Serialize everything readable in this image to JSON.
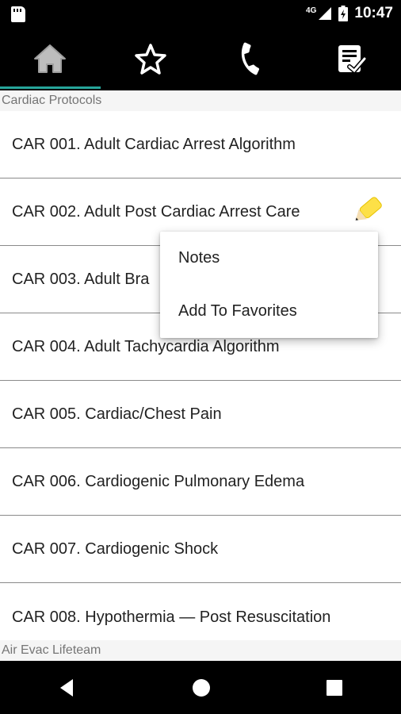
{
  "status_bar": {
    "network": "4G",
    "time": "10:47"
  },
  "tabs": [
    {
      "icon": "home-icon",
      "active": true
    },
    {
      "icon": "star-icon",
      "active": false
    },
    {
      "icon": "phone-icon",
      "active": false
    },
    {
      "icon": "checklist-icon",
      "active": false
    }
  ],
  "section_title": "Cardiac Protocols",
  "protocols": [
    "CAR 001. Adult Cardiac Arrest Algorithm",
    "CAR 002. Adult Post Cardiac Arrest Care",
    "CAR 003. Adult Bra",
    "CAR 004. Adult Tachycardia Algorithm",
    "CAR 005. Cardiac/Chest Pain",
    "CAR 006. Cardiogenic Pulmonary Edema",
    "CAR 007. Cardiogenic Shock",
    "CAR 008. Hypothermia — Post Resuscitation"
  ],
  "context_menu": {
    "notes": "Notes",
    "favorites": "Add To Favorites"
  },
  "footer_label": "Air Evac Lifeteam",
  "colors": {
    "accent": "#26a69a",
    "pencil": "#fde047"
  }
}
